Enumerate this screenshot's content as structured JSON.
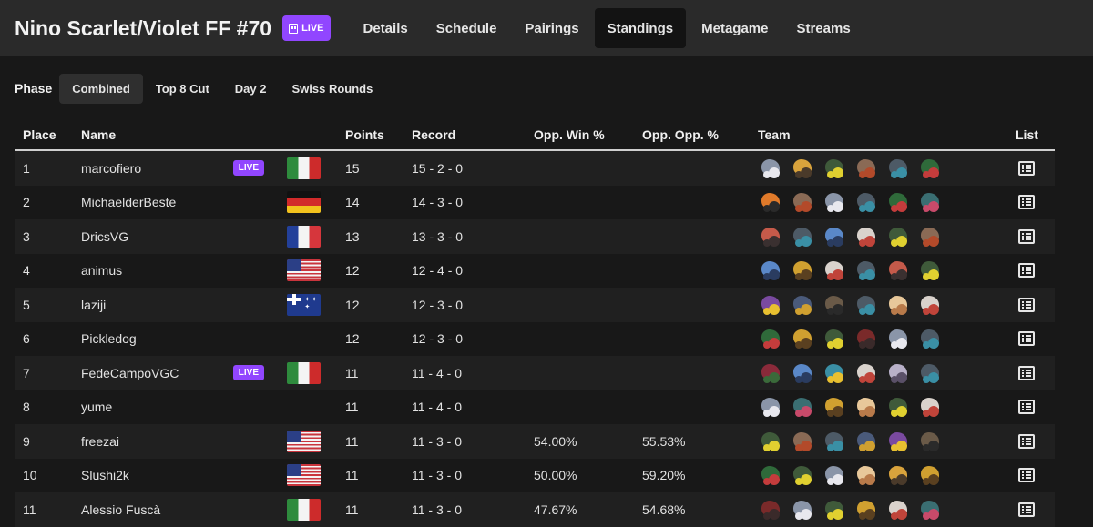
{
  "header": {
    "title": "Nino Scarlet/Violet FF #70",
    "live_label": "LIVE",
    "tabs": [
      "Details",
      "Schedule",
      "Pairings",
      "Standings",
      "Metagame",
      "Streams"
    ],
    "active_tab": "Standings"
  },
  "phase": {
    "label": "Phase",
    "options": [
      "Combined",
      "Top 8 Cut",
      "Day 2",
      "Swiss Rounds"
    ],
    "active": "Combined"
  },
  "table": {
    "columns": [
      "Place",
      "Name",
      "Points",
      "Record",
      "Opp. Win %",
      "Opp. Opp. %",
      "Team",
      "List"
    ],
    "rows": [
      {
        "place": "1",
        "name": "marcofiero",
        "live": "LIVE",
        "flag": "it",
        "points": "15",
        "record": "15 - 2 - 0",
        "opp_win": "",
        "opp_opp": "",
        "team": [
          [
            "#8a95a8",
            "#e8e8ee"
          ],
          [
            "#d9a33c",
            "#4a3a2a"
          ],
          [
            "#3f5a3a",
            "#e0d030"
          ],
          [
            "#8a6a55",
            "#b34a2a"
          ],
          [
            "#4d5a66",
            "#3a8fa5"
          ],
          [
            "#2f6a3a",
            "#c43c3c"
          ]
        ]
      },
      {
        "place": "2",
        "name": "MichaelderBeste",
        "live": "",
        "flag": "de",
        "points": "14",
        "record": "14 - 3 - 0",
        "opp_win": "",
        "opp_opp": "",
        "team": [
          [
            "#e07a2a",
            "#2a2a2a"
          ],
          [
            "#8a6a55",
            "#b34a2a"
          ],
          [
            "#8a95a8",
            "#e8e8ee"
          ],
          [
            "#4d5a66",
            "#3a8fa5"
          ],
          [
            "#2f6a3a",
            "#c43c3c"
          ],
          [
            "#3a6e72",
            "#c84a6a"
          ]
        ]
      },
      {
        "place": "3",
        "name": "DricsVG",
        "live": "",
        "flag": "fr",
        "points": "13",
        "record": "13 - 3 - 0",
        "opp_win": "",
        "opp_opp": "",
        "team": [
          [
            "#c55a4a",
            "#3a3030"
          ],
          [
            "#4d5a66",
            "#3a8fa5"
          ],
          [
            "#5a88c8",
            "#2a3c60"
          ],
          [
            "#d9d2cc",
            "#c0443a"
          ],
          [
            "#3f5a3a",
            "#e0d030"
          ],
          [
            "#8a6a55",
            "#b34a2a"
          ]
        ]
      },
      {
        "place": "4",
        "name": "animus",
        "live": "",
        "flag": "us",
        "points": "12",
        "record": "12 - 4 - 0",
        "opp_win": "",
        "opp_opp": "",
        "team": [
          [
            "#5a88c8",
            "#2a3c60"
          ],
          [
            "#d0a030",
            "#5a4020"
          ],
          [
            "#d9d2cc",
            "#c0443a"
          ],
          [
            "#4d5a66",
            "#3a8fa5"
          ],
          [
            "#c55a4a",
            "#3a3030"
          ],
          [
            "#3f5a3a",
            "#e0d030"
          ]
        ]
      },
      {
        "place": "5",
        "name": "laziji",
        "live": "",
        "flag": "au",
        "points": "12",
        "record": "12 - 3 - 0",
        "opp_win": "",
        "opp_opp": "",
        "team": [
          [
            "#7a4aa0",
            "#e8c030"
          ],
          [
            "#4a5a7a",
            "#d0a030"
          ],
          [
            "#6a5a48",
            "#2a2a2a"
          ],
          [
            "#4d5a66",
            "#3a8fa5"
          ],
          [
            "#e8c89a",
            "#b87a4a"
          ],
          [
            "#d9d2cc",
            "#c0443a"
          ]
        ]
      },
      {
        "place": "6",
        "name": "Pickledog",
        "live": "",
        "flag": "",
        "points": "12",
        "record": "12 - 3 - 0",
        "opp_win": "",
        "opp_opp": "",
        "team": [
          [
            "#2f6a3a",
            "#c43c3c"
          ],
          [
            "#d0a030",
            "#5a4020"
          ],
          [
            "#3f5a3a",
            "#e0d030"
          ],
          [
            "#7a2a2a",
            "#3a2a2a"
          ],
          [
            "#8a95a8",
            "#e8e8ee"
          ],
          [
            "#4d5a66",
            "#3a8fa5"
          ]
        ]
      },
      {
        "place": "7",
        "name": "FedeCampoVGC",
        "live": "LIVE",
        "flag": "it",
        "points": "11",
        "record": "11 - 4 - 0",
        "opp_win": "",
        "opp_opp": "",
        "team": [
          [
            "#8a2a3a",
            "#3a6a3a"
          ],
          [
            "#5a88c8",
            "#2a3c60"
          ],
          [
            "#3a8fa5",
            "#e8c030"
          ],
          [
            "#d9d2cc",
            "#c0443a"
          ],
          [
            "#b8b0c8",
            "#5a5068"
          ],
          [
            "#4d5a66",
            "#3a8fa5"
          ]
        ]
      },
      {
        "place": "8",
        "name": "yume",
        "live": "",
        "flag": "",
        "points": "11",
        "record": "11 - 4 - 0",
        "opp_win": "",
        "opp_opp": "",
        "team": [
          [
            "#8a95a8",
            "#e8e8ee"
          ],
          [
            "#3a6e72",
            "#c84a6a"
          ],
          [
            "#d0a030",
            "#5a4020"
          ],
          [
            "#e8c89a",
            "#b87a4a"
          ],
          [
            "#3f5a3a",
            "#e0d030"
          ],
          [
            "#d9d2cc",
            "#c0443a"
          ]
        ]
      },
      {
        "place": "9",
        "name": "freezai",
        "live": "",
        "flag": "us",
        "points": "11",
        "record": "11 - 3 - 0",
        "opp_win": "54.00%",
        "opp_opp": "55.53%",
        "team": [
          [
            "#3f5a3a",
            "#e0d030"
          ],
          [
            "#8a6a55",
            "#b34a2a"
          ],
          [
            "#4d5a66",
            "#3a8fa5"
          ],
          [
            "#4a5a7a",
            "#d0a030"
          ],
          [
            "#7a4aa0",
            "#e8c030"
          ],
          [
            "#6a5a48",
            "#2a2a2a"
          ]
        ]
      },
      {
        "place": "10",
        "name": "Slushi2k",
        "live": "",
        "flag": "us",
        "points": "11",
        "record": "11 - 3 - 0",
        "opp_win": "50.00%",
        "opp_opp": "59.20%",
        "team": [
          [
            "#2f6a3a",
            "#c43c3c"
          ],
          [
            "#3f5a3a",
            "#e0d030"
          ],
          [
            "#8a95a8",
            "#e8e8ee"
          ],
          [
            "#e8c89a",
            "#b87a4a"
          ],
          [
            "#d9a33c",
            "#4a3a2a"
          ],
          [
            "#d0a030",
            "#5a4020"
          ]
        ]
      },
      {
        "place": "11",
        "name": "Alessio Fuscà",
        "live": "",
        "flag": "it",
        "points": "11",
        "record": "11 - 3 - 0",
        "opp_win": "47.67%",
        "opp_opp": "54.68%",
        "team": [
          [
            "#7a2a2a",
            "#3a2a2a"
          ],
          [
            "#8a95a8",
            "#e8e8ee"
          ],
          [
            "#3f5a3a",
            "#e0d030"
          ],
          [
            "#d0a030",
            "#5a4020"
          ],
          [
            "#d9d2cc",
            "#c0443a"
          ],
          [
            "#3a6e72",
            "#c84a6a"
          ]
        ]
      }
    ]
  }
}
